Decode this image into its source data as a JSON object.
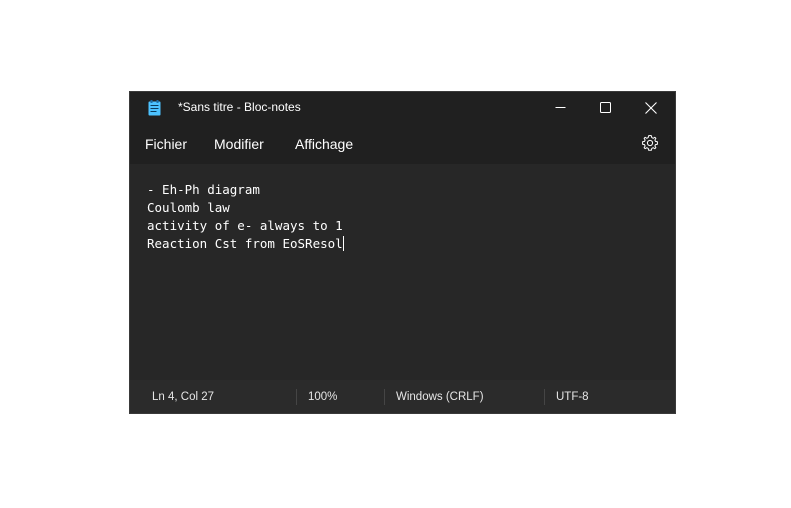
{
  "window": {
    "title": "*Sans titre - Bloc-notes"
  },
  "menu": {
    "items": [
      "Fichier",
      "Modifier",
      "Affichage"
    ]
  },
  "editor": {
    "lines": [
      "- Eh-Ph diagram",
      "Coulomb law",
      "activity of e- always to 1",
      "Reaction Cst from EoSResol"
    ]
  },
  "status": {
    "position": "Ln 4, Col 27",
    "zoom": "100%",
    "line_ending": "Windows (CRLF)",
    "encoding": "UTF-8"
  },
  "icons": {
    "app": "notepad-icon",
    "minimize": "minimize-icon",
    "maximize": "maximize-icon",
    "close": "close-icon",
    "settings": "gear-icon"
  },
  "colors": {
    "titlebar": "#202020",
    "editor_bg": "#272727",
    "statusbar": "#2b2b2b",
    "icon_accent": "#4cc2ff"
  }
}
